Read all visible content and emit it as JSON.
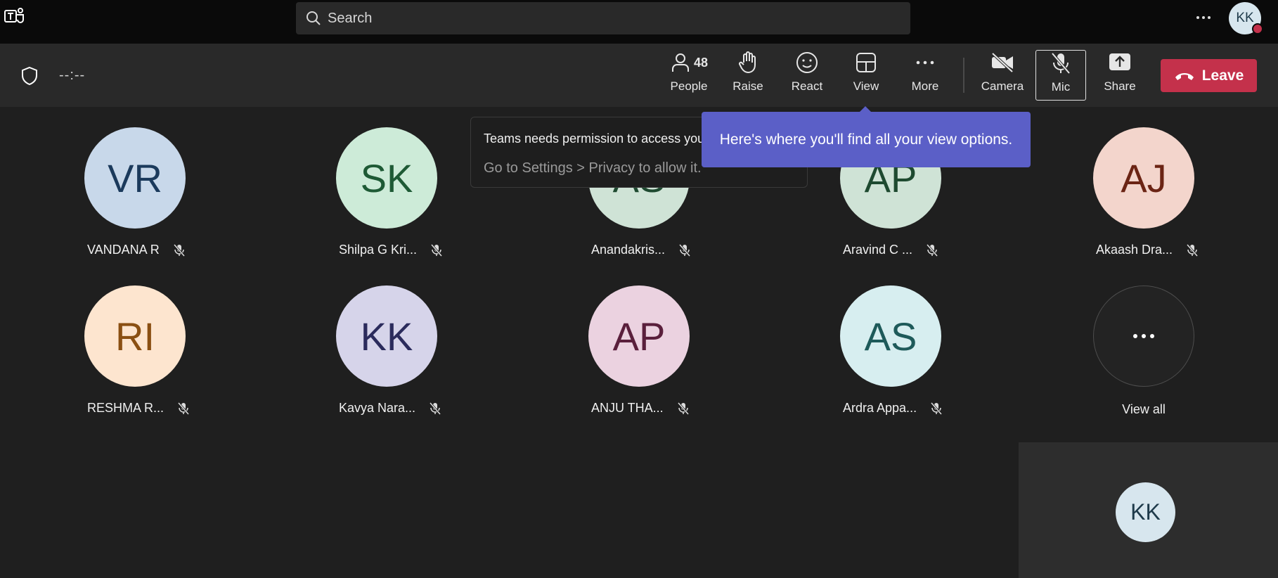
{
  "titlebar": {
    "search_placeholder": "Search",
    "account_initials": "KK"
  },
  "toolbar": {
    "timer": "--:--",
    "people_label": "People",
    "people_count": "48",
    "raise_label": "Raise",
    "react_label": "React",
    "view_label": "View",
    "more_label": "More",
    "camera_label": "Camera",
    "mic_label": "Mic",
    "share_label": "Share",
    "leave_label": "Leave"
  },
  "permission_popup": {
    "line1": "Teams needs permission to access your",
    "line2": "Go to Settings > Privacy to allow it."
  },
  "coachmark": {
    "text": "Here's where you'll find all your view options."
  },
  "participants": [
    {
      "initials": "VR",
      "name": "VANDANA R",
      "bg": "#c8d8ea",
      "fg": "#1b3a5c"
    },
    {
      "initials": "SK",
      "name": "Shilpa G Kri...",
      "bg": "#cdebd8",
      "fg": "#1e5a35"
    },
    {
      "initials": "AS",
      "name": "Anandakris...",
      "bg": "#cfe3d6",
      "fg": "#1e4a30"
    },
    {
      "initials": "AP",
      "name": "Aravind C ...",
      "bg": "#cfe3d6",
      "fg": "#1e4a30"
    },
    {
      "initials": "AJ",
      "name": "Akaash Dra...",
      "bg": "#f3d5cc",
      "fg": "#6b2414"
    },
    {
      "initials": "RI",
      "name": "RESHMA R...",
      "bg": "#fde5cf",
      "fg": "#8a4f12"
    },
    {
      "initials": "KK",
      "name": "Kavya Nara...",
      "bg": "#d6d4ea",
      "fg": "#2b2b5c"
    },
    {
      "initials": "AP",
      "name": "ANJU THA...",
      "bg": "#ebd2e0",
      "fg": "#5a1f3c"
    },
    {
      "initials": "AS",
      "name": "Ardra Appa...",
      "bg": "#d7eef0",
      "fg": "#1e5a5a"
    }
  ],
  "view_all": {
    "label": "View all"
  },
  "self_view": {
    "initials": "KK"
  }
}
